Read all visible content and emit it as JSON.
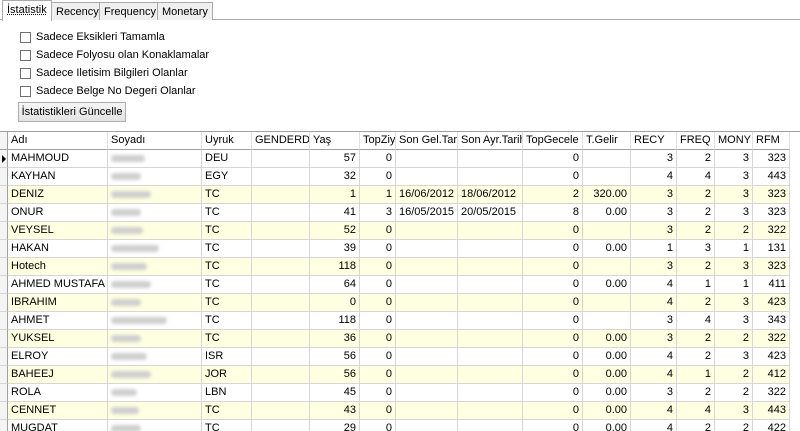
{
  "tabs": [
    "İstatistik",
    "Recency",
    "Frequency",
    "Monetary"
  ],
  "options": [
    "Sadece Eksikleri Tamamla",
    "Sadece Folyosu olan Konaklamalar",
    "Sadece Iletisim Bilgileri Olanlar",
    "Sadece Belge No Degeri Olanlar"
  ],
  "update_button": "İstatistikleri Güncelle",
  "columns": [
    "Adı",
    "Soyadı",
    "Uyruk",
    "GENDERDE",
    "Yaş",
    "TopZiyar",
    "Son Gel.Tari",
    "Son Ayr.Tarih",
    "TopGecele",
    "T.Gelir",
    "RECY",
    "FREQ",
    "MONY",
    "RFM"
  ],
  "rows": [
    {
      "adi": "MAHMOUD",
      "uyruk": "DEU",
      "gender": "",
      "yas": "57",
      "top_ziyaret": "0",
      "son_gel": "",
      "son_ayr": "",
      "top_gecele": "0",
      "gelir": "",
      "recy": "3",
      "freq": "2",
      "mony": "3",
      "rfm": "323"
    },
    {
      "adi": "KAYHAN",
      "uyruk": "EGY",
      "gender": "",
      "yas": "32",
      "top_ziyaret": "0",
      "son_gel": "",
      "son_ayr": "",
      "top_gecele": "0",
      "gelir": "",
      "recy": "4",
      "freq": "4",
      "mony": "3",
      "rfm": "443"
    },
    {
      "adi": "DENIZ",
      "uyruk": "TC",
      "gender": "",
      "yas": "1",
      "top_ziyaret": "1",
      "son_gel": "16/06/2012",
      "son_ayr": "18/06/2012",
      "top_gecele": "2",
      "gelir": "320.00",
      "recy": "3",
      "freq": "2",
      "mony": "3",
      "rfm": "323"
    },
    {
      "adi": "ONUR",
      "uyruk": "TC",
      "gender": "",
      "yas": "41",
      "top_ziyaret": "3",
      "son_gel": "16/05/2015",
      "son_ayr": "20/05/2015",
      "top_gecele": "8",
      "gelir": "0.00",
      "recy": "3",
      "freq": "2",
      "mony": "3",
      "rfm": "323"
    },
    {
      "adi": "VEYSEL",
      "uyruk": "TC",
      "gender": "",
      "yas": "52",
      "top_ziyaret": "0",
      "son_gel": "",
      "son_ayr": "",
      "top_gecele": "0",
      "gelir": "",
      "recy": "3",
      "freq": "2",
      "mony": "2",
      "rfm": "322"
    },
    {
      "adi": "HAKAN",
      "uyruk": "TC",
      "gender": "",
      "yas": "39",
      "top_ziyaret": "0",
      "son_gel": "",
      "son_ayr": "",
      "top_gecele": "0",
      "gelir": "0.00",
      "recy": "1",
      "freq": "3",
      "mony": "1",
      "rfm": "131"
    },
    {
      "adi": "Hotech",
      "uyruk": "TC",
      "gender": "",
      "yas": "118",
      "top_ziyaret": "0",
      "son_gel": "",
      "son_ayr": "",
      "top_gecele": "0",
      "gelir": "",
      "recy": "3",
      "freq": "2",
      "mony": "3",
      "rfm": "323"
    },
    {
      "adi": "AHMED MUSTAFA",
      "uyruk": "TC",
      "gender": "",
      "yas": "64",
      "top_ziyaret": "0",
      "son_gel": "",
      "son_ayr": "",
      "top_gecele": "0",
      "gelir": "0.00",
      "recy": "4",
      "freq": "1",
      "mony": "1",
      "rfm": "411"
    },
    {
      "adi": "IBRAHIM",
      "uyruk": "TC",
      "gender": "",
      "yas": "0",
      "top_ziyaret": "0",
      "son_gel": "",
      "son_ayr": "",
      "top_gecele": "0",
      "gelir": "",
      "recy": "4",
      "freq": "2",
      "mony": "3",
      "rfm": "423"
    },
    {
      "adi": "AHMET",
      "uyruk": "TC",
      "gender": "",
      "yas": "118",
      "top_ziyaret": "0",
      "son_gel": "",
      "son_ayr": "",
      "top_gecele": "0",
      "gelir": "",
      "recy": "3",
      "freq": "4",
      "mony": "3",
      "rfm": "343"
    },
    {
      "adi": "YUKSEL",
      "uyruk": "TC",
      "gender": "",
      "yas": "36",
      "top_ziyaret": "0",
      "son_gel": "",
      "son_ayr": "",
      "top_gecele": "0",
      "gelir": "0.00",
      "recy": "3",
      "freq": "2",
      "mony": "2",
      "rfm": "322"
    },
    {
      "adi": "ELROY",
      "uyruk": "ISR",
      "gender": "",
      "yas": "56",
      "top_ziyaret": "0",
      "son_gel": "",
      "son_ayr": "",
      "top_gecele": "0",
      "gelir": "0.00",
      "recy": "4",
      "freq": "2",
      "mony": "3",
      "rfm": "423"
    },
    {
      "adi": "BAHEEJ",
      "uyruk": "JOR",
      "gender": "",
      "yas": "56",
      "top_ziyaret": "0",
      "son_gel": "",
      "son_ayr": "",
      "top_gecele": "0",
      "gelir": "0.00",
      "recy": "4",
      "freq": "1",
      "mony": "2",
      "rfm": "412"
    },
    {
      "adi": "ROLA",
      "uyruk": "LBN",
      "gender": "",
      "yas": "45",
      "top_ziyaret": "0",
      "son_gel": "",
      "son_ayr": "",
      "top_gecele": "0",
      "gelir": "0.00",
      "recy": "3",
      "freq": "2",
      "mony": "2",
      "rfm": "322"
    },
    {
      "adi": "CENNET",
      "uyruk": "TC",
      "gender": "",
      "yas": "43",
      "top_ziyaret": "0",
      "son_gel": "",
      "son_ayr": "",
      "top_gecele": "0",
      "gelir": "0.00",
      "recy": "4",
      "freq": "4",
      "mony": "3",
      "rfm": "443"
    },
    {
      "adi": "MUGDAT",
      "uyruk": "TC",
      "gender": "",
      "yas": "29",
      "top_ziyaret": "0",
      "son_gel": "",
      "son_ayr": "",
      "top_gecele": "0",
      "gelir": "0.00",
      "recy": "4",
      "freq": "2",
      "mony": "2",
      "rfm": "422"
    }
  ]
}
